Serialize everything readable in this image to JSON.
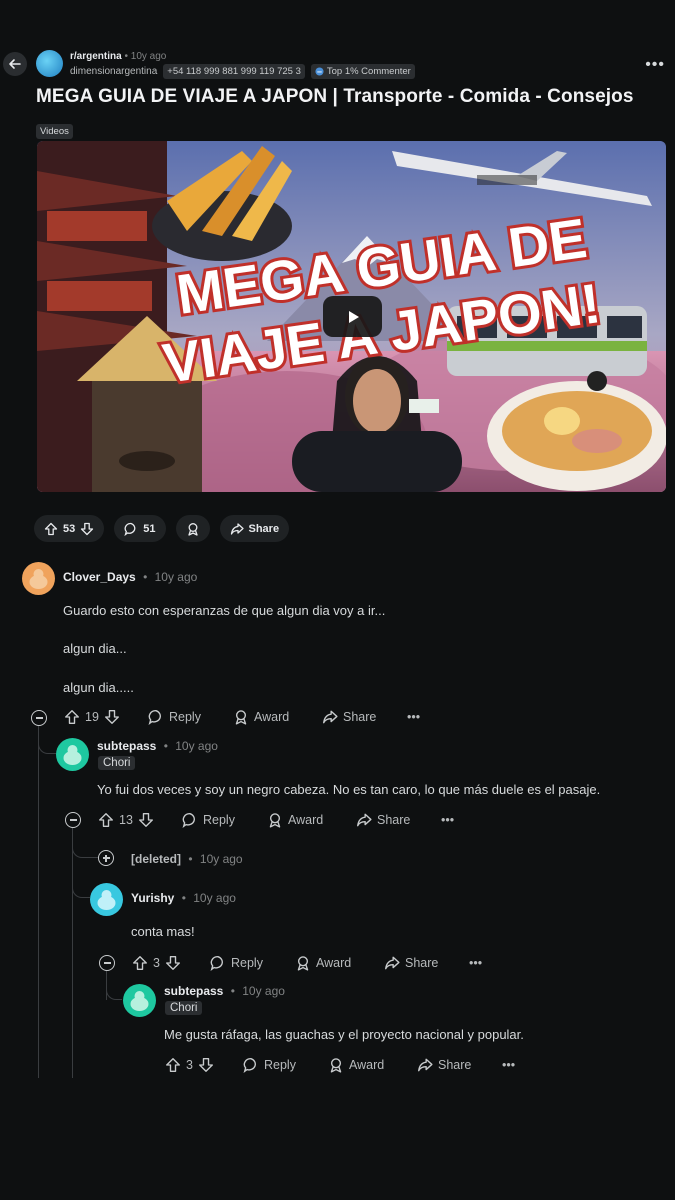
{
  "header": {
    "subreddit": "r/argentina",
    "sep": "•",
    "time": "10y ago",
    "author": "dimensionargentina",
    "flair": "+54 118 999 881 999 119 725 3",
    "badge": "Top 1% Commenter"
  },
  "post": {
    "title": "MEGA GUIA DE VIAJE A JAPON | Transporte - Comida - Consejos",
    "tag": "Videos",
    "thumbnail_text": [
      "MEGA GUIA DE",
      "VIAJE A JAPON!"
    ],
    "upvotes": "53",
    "comments": "51",
    "share": "Share"
  },
  "labels": {
    "reply": "Reply",
    "award": "Award",
    "share": "Share",
    "dot": "•"
  },
  "comments": [
    {
      "user": "Clover_Days",
      "time": "10y ago",
      "lines": [
        "Guardo esto con esperanzas de que algun dia voy a ir...",
        "algun dia...",
        "algun dia....."
      ],
      "votes": "19",
      "avatar_color": "#f0a35c"
    },
    {
      "user": "subtepass",
      "time": "10y ago",
      "flair": "Chori",
      "lines": [
        "Yo fui dos veces y soy un negro cabeza. No es tan caro, lo que más duele es el pasaje."
      ],
      "votes": "13",
      "avatar_color": "#1ec8a0"
    },
    {
      "user": "[deleted]",
      "time": "10y ago"
    },
    {
      "user": "Yurishy",
      "time": "10y ago",
      "lines": [
        "conta mas!"
      ],
      "votes": "3",
      "avatar_color": "#38c8e0"
    },
    {
      "user": "subtepass",
      "time": "10y ago",
      "flair": "Chori",
      "lines": [
        "Me gusta ráfaga, las guachas y el proyecto nacional y popular."
      ],
      "votes": "3",
      "avatar_color": "#1ec8a0"
    }
  ]
}
